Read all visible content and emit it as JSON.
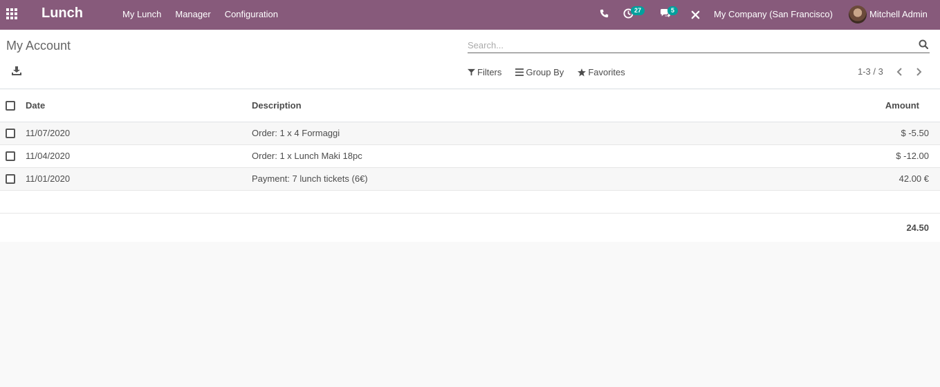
{
  "navbar": {
    "brand": "Lunch",
    "menu": [
      "My Lunch",
      "Manager",
      "Configuration"
    ],
    "activity_count": "27",
    "message_count": "5",
    "company": "My Company (San Francisco)",
    "user": "Mitchell Admin"
  },
  "control_panel": {
    "breadcrumb": "My Account",
    "search_placeholder": "Search...",
    "filters_label": "Filters",
    "groupby_label": "Group By",
    "favorites_label": "Favorites",
    "pager": "1-3 / 3"
  },
  "table": {
    "headers": {
      "date": "Date",
      "description": "Description",
      "amount": "Amount"
    },
    "rows": [
      {
        "date": "11/07/2020",
        "description": "Order: 1 x 4 Formaggi",
        "amount": "$ -5.50"
      },
      {
        "date": "11/04/2020",
        "description": "Order: 1 x Lunch Maki 18pc",
        "amount": "$ -12.00"
      },
      {
        "date": "11/01/2020",
        "description": "Payment: 7 lunch tickets (6€)",
        "amount": "42.00 €"
      }
    ],
    "total": "24.50"
  },
  "colors": {
    "brand": "#875a7b",
    "badge": "#00a09d"
  }
}
